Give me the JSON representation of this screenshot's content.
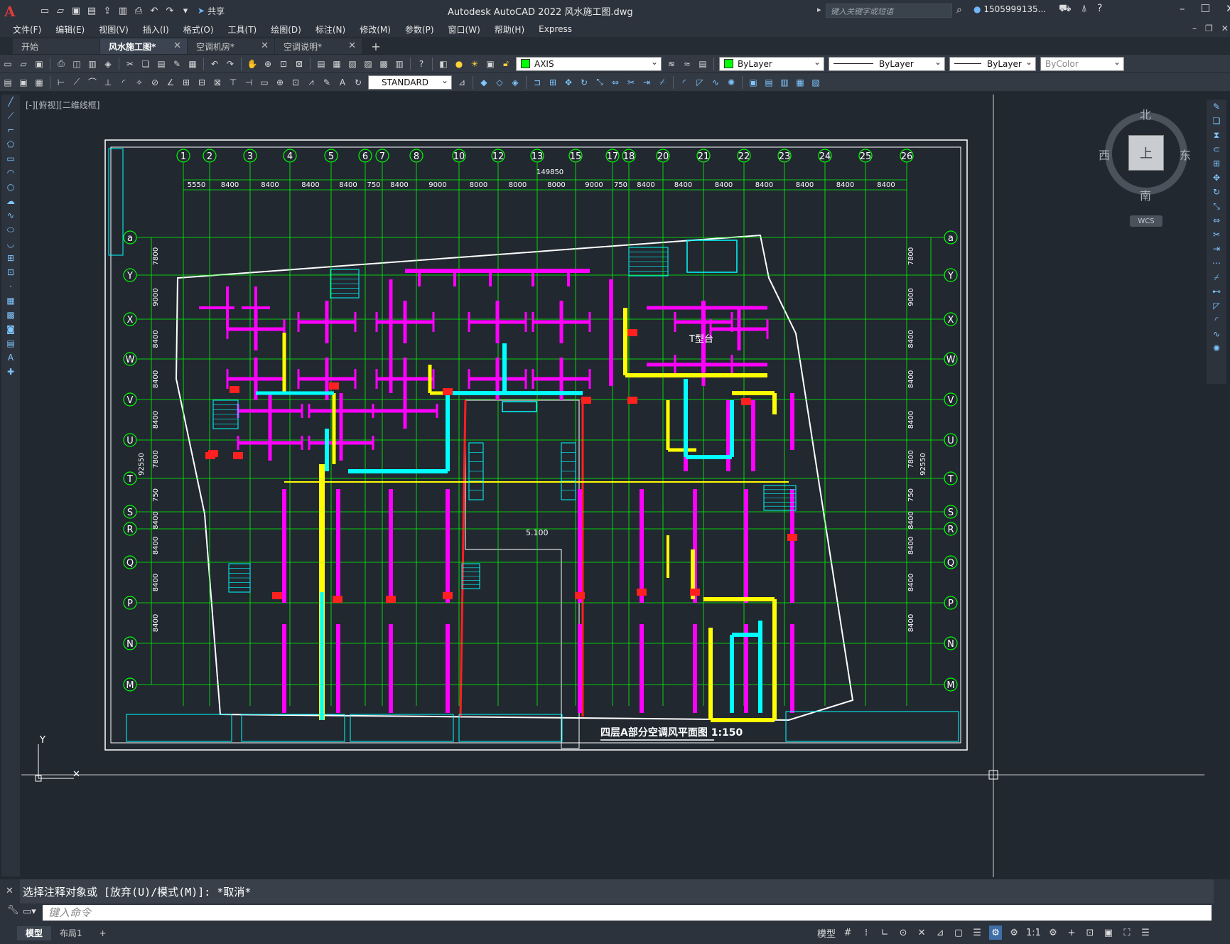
{
  "app": {
    "title": "Autodesk AutoCAD 2022    风水施工图.dwg",
    "search_placeholder": "键入关键字或短语",
    "user": "1505999135...",
    "share_label": "共享",
    "logo": "A"
  },
  "menu": [
    "文件(F)",
    "编辑(E)",
    "视图(V)",
    "插入(I)",
    "格式(O)",
    "工具(T)",
    "绘图(D)",
    "标注(N)",
    "修改(M)",
    "参数(P)",
    "窗口(W)",
    "帮助(H)",
    "Express"
  ],
  "tabs": [
    {
      "label": "开始",
      "active": false,
      "closable": false
    },
    {
      "label": "风水施工图*",
      "active": true,
      "closable": true
    },
    {
      "label": "空调机房*",
      "active": false,
      "closable": true
    },
    {
      "label": "空调说明*",
      "active": false,
      "closable": true
    }
  ],
  "toolbar": {
    "layer": "AXIS",
    "color": "ByLayer",
    "linetype": "ByLayer",
    "lineweight": "ByLayer",
    "plotstyle": "ByColor",
    "textstyle": "STANDARD"
  },
  "viewport": {
    "label": "[-][俯视][二维线框]"
  },
  "viewcube": {
    "top": "上",
    "north": "北",
    "south": "南",
    "east": "东",
    "west": "西",
    "wcs": "WCS"
  },
  "drawing": {
    "col_axes": [
      "1",
      "2",
      "3",
      "4",
      "5",
      "6",
      "7",
      "8",
      "10",
      "12",
      "13",
      "15",
      "17",
      "18",
      "20",
      "21",
      "22",
      "23",
      "24",
      "25",
      "26"
    ],
    "row_axes": [
      "a",
      "Y",
      "X",
      "W",
      "V",
      "U",
      "T",
      "S",
      "R",
      "Q",
      "P",
      "N",
      "M"
    ],
    "total_dim": "149850",
    "col_dims": [
      "5550",
      "8400",
      "8400",
      "8400",
      "8400",
      "750",
      "8400",
      "9000",
      "8000",
      "8000",
      "8000",
      "9000",
      "750",
      "8400",
      "8400",
      "8400",
      "8400",
      "8400",
      "8400",
      "8400"
    ],
    "row_dims": [
      "7800",
      "9000",
      "8400",
      "8400",
      "8400",
      "7800",
      "750",
      "8400",
      "8400",
      "8400",
      "8400"
    ],
    "total_row_dim": "92550",
    "title": "四层A部分空调风平面图 1:150",
    "room_label": "T型台",
    "elevation": "5.100"
  },
  "command": {
    "history": "选择注释对象或 [放弃(U)/模式(M)]: *取消*",
    "placeholder": "键入命令"
  },
  "status": {
    "tabs": [
      "模型",
      "布局1"
    ],
    "active_tab": "模型",
    "model_label": "模型",
    "scale": "1:1"
  },
  "colors": {
    "magenta": "#ff00ff",
    "yellow": "#ffff00",
    "cyan": "#00ffff",
    "green": "#00ff00",
    "red": "#ff2020",
    "white": "#ffffff"
  }
}
